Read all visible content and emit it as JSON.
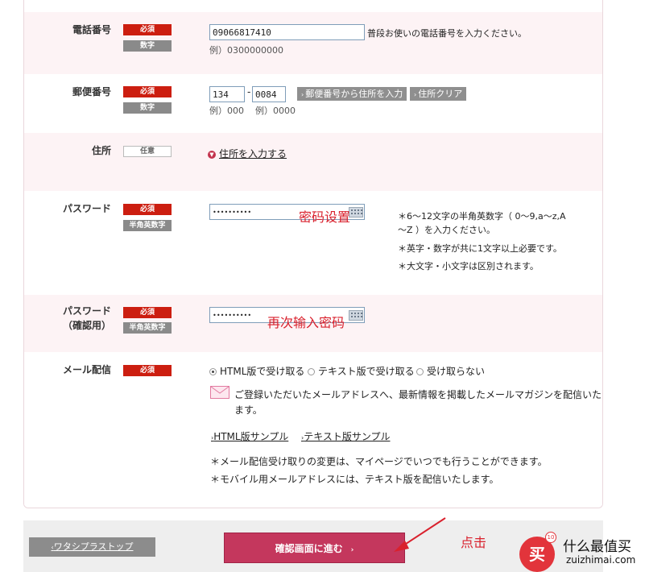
{
  "phone": {
    "label": "電話番号",
    "required": "必須",
    "kind": "数字",
    "value": "09066817410",
    "description": "普段お使いの電話番号を入力ください。",
    "example": "例）0300000000"
  },
  "postal": {
    "label": "郵便番号",
    "required": "必須",
    "kind": "数字",
    "value1": "134",
    "dash": "-",
    "value2": "0084",
    "lookup_button": "郵便番号から住所を入力",
    "clear_button": "住所クリア",
    "example1": "例）000",
    "example2": "例）0000"
  },
  "address": {
    "label": "住所",
    "optional": "任意",
    "toggle_link": "住所を入力する"
  },
  "password": {
    "label": "パスワード",
    "required": "必須",
    "kind": "半角英数字",
    "value": "••••••••••",
    "annotation": "密码设置",
    "rule1a": "＊6～12文字の半角英数字（ 0～9,a～z,A",
    "rule1b": "～Z ）を入力ください。",
    "rule2": "＊英字・数字が共に1文字以上必要です。",
    "rule3": "＊大文字・小文字は区別されます。"
  },
  "password_confirm": {
    "label_line1": "パスワード",
    "label_line2": "（確認用）",
    "required": "必須",
    "kind": "半角英数字",
    "value": "••••••••••",
    "annotation": "再次输入密码"
  },
  "mail": {
    "label": "メール配信",
    "required": "必須",
    "options": [
      "HTML版で受け取る",
      "テキスト版で受け取る",
      "受け取らない"
    ],
    "selected": "HTML版で受け取る",
    "notice_line1": "ご登録いただいたメールアドレスへ、最新情報を掲載したメールマガジンを配信いたし",
    "notice_line2": "ます。",
    "html_sample": "HTML版サンプル",
    "text_sample": "テキスト版サンプル",
    "note1": "＊メール配信受け取りの変更は、マイページでいつでも行うことができます。",
    "note2": "＊モバイル用メールアドレスには、テキスト版を配信いたします。"
  },
  "footer": {
    "back_button": "ワタシプラストップ",
    "confirm_button": "確認画面に進む",
    "annotation": "点击"
  },
  "watermark": {
    "cn": "什么最值买",
    "en": "zuizhimai.com",
    "badge": "买",
    "ten": "10"
  },
  "colors": {
    "required_badge": "#cc1e10",
    "confirm_button": "#c4375d",
    "annotation": "#d9212d",
    "pink_row": "#fdf3f5"
  }
}
